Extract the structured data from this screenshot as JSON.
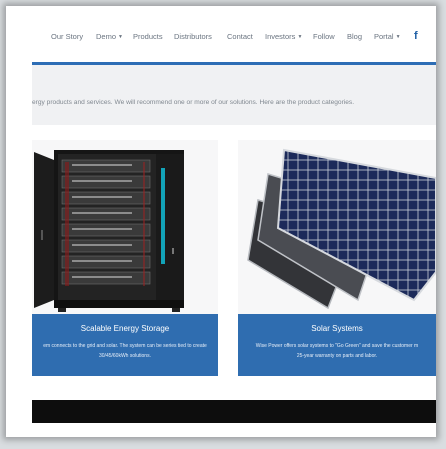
{
  "nav": {
    "items": [
      {
        "label": "Our Story",
        "has_caret": false
      },
      {
        "label": "Demo",
        "has_caret": true
      },
      {
        "label": "Products",
        "has_caret": false
      },
      {
        "label": "Distributors",
        "has_caret": false
      },
      {
        "label": "Contact",
        "has_caret": false
      },
      {
        "label": "Investors",
        "has_caret": true
      },
      {
        "label": "Follow",
        "has_caret": false
      },
      {
        "label": "Blog",
        "has_caret": false
      },
      {
        "label": "Portal",
        "has_caret": true
      }
    ],
    "social_icon": "facebook-icon",
    "social_glyph": "f"
  },
  "intro_text": "ergy products and services. We will recommend one or more of our solutions. Here are the product categories.",
  "products": [
    {
      "title": "Scalable Energy Storage",
      "description_line1": "em connects to the grid and solar. The system can be series tied to create",
      "description_line2": "30/45/60kWh solutions."
    },
    {
      "title": "Solar Systems",
      "description_line1": "Wise Power offers solar systems to \"Go Green\" and save the customer m",
      "description_line2": "25-year warranty on parts and labor."
    }
  ],
  "colors": {
    "brand_blue": "#2f6db0",
    "nav_text": "#6a7480",
    "footer_bar": "#0d0d0d"
  }
}
